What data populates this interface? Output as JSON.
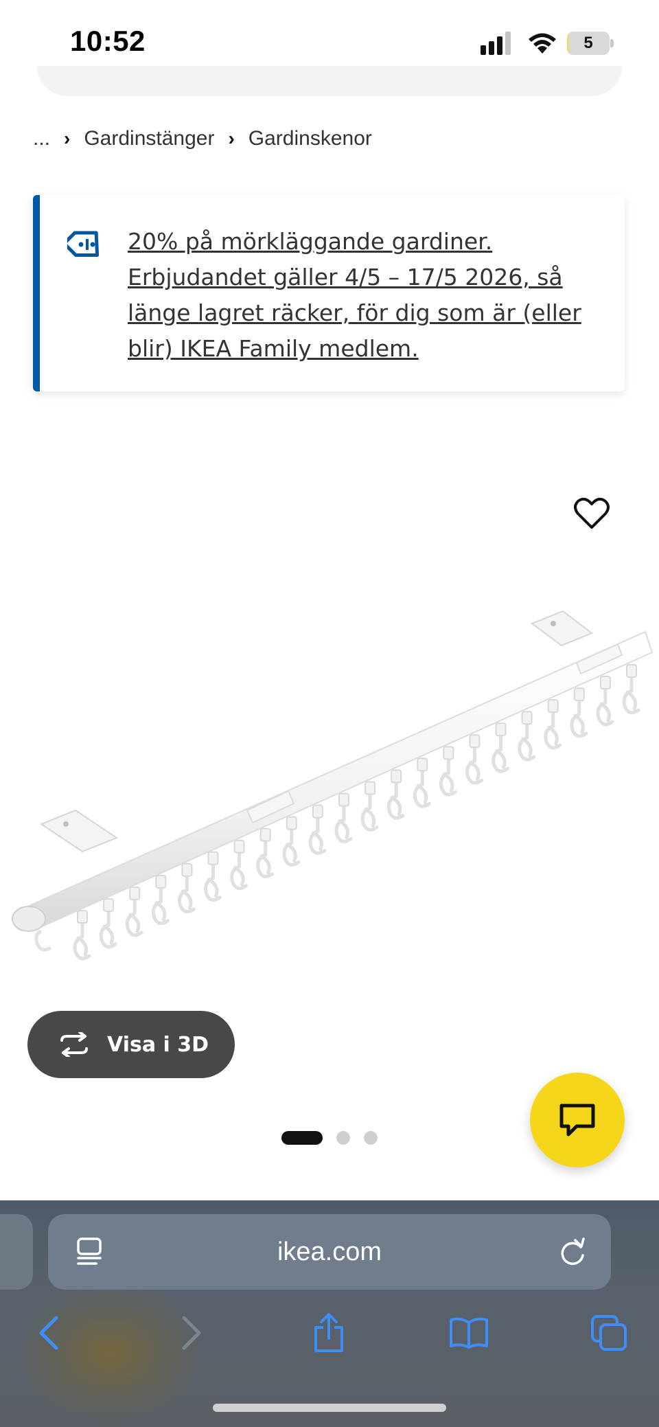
{
  "status_bar": {
    "time": "10:52",
    "battery_level": "5",
    "battery_fraction": 0.05
  },
  "breadcrumb": {
    "items": [
      "...",
      "Gardinstänger",
      "Gardinskenor"
    ],
    "separator": "›"
  },
  "promo": {
    "text": "20% på mörkläggande gardiner. Erbjudandet gäller 4/5 – 17/5 2026, så länge lagret räcker, för dig som är (eller blir) IKEA Family medlem.",
    "icon": "price-tag-icon",
    "accent_color": "#0058a3"
  },
  "product": {
    "image_icon": "curtain-track-image",
    "view_3d_label": "Visa i 3D",
    "carousel": {
      "total": 3,
      "active": 0
    }
  },
  "chat": {
    "icon": "chat-icon",
    "color": "#f6d61a"
  },
  "browser": {
    "url": "ikea.com",
    "icons": [
      "reader-icon",
      "reload-icon",
      "back-icon",
      "forward-icon",
      "share-icon",
      "bookmarks-icon",
      "tabs-icon"
    ]
  }
}
